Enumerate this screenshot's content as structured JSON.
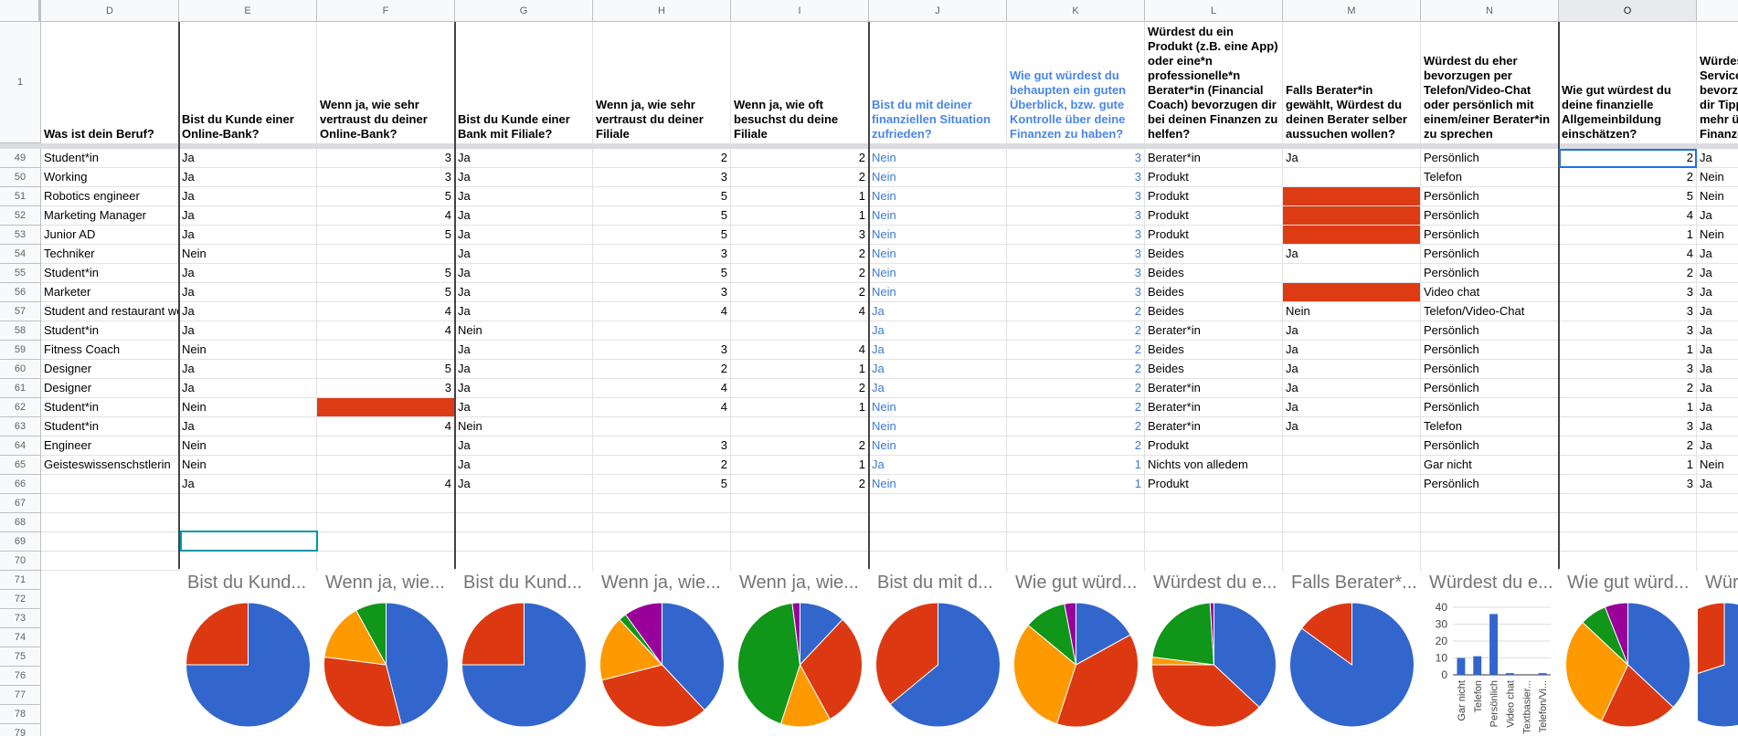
{
  "columns": [
    "D",
    "E",
    "F",
    "G",
    "H",
    "I",
    "J",
    "K",
    "L",
    "M",
    "N",
    "O",
    ""
  ],
  "selected_column": "O",
  "header_row_number": "1",
  "headers": [
    "Was ist dein Beruf?",
    "Bist du Kunde einer Online-Bank?",
    "Wenn ja, wie sehr vertraust du deiner Online-Bank?",
    "Bist du Kunde einer Bank mit Filiale?",
    "Wenn ja, wie sehr vertraust du deiner Filiale",
    "Wenn ja, wie oft besuchst du deine Filiale",
    "Bist du mit deiner finanziellen Situation zufrieden?",
    "Wie gut würdest du behaupten ein guten Überblick, bzw. gute Kontrolle über deine Finanzen zu haben?",
    "Würdest du ein Produkt (z.B. eine App) oder eine*n professionelle*n Berater*in (Financial Coach) bevorzugen dir bei deinen Finanzen zu helfen?",
    "Falls Berater*in gewählt, Würdest du deinen Berater selber aussuchen wollen?",
    "Würdest du eher bevorzugen per Telefon/Video-Chat oder persönlich mit einem/einer Berater*in zu sprechen",
    "Wie gut würdest du deine finanzielle Allgemeinbildung einschätzen?",
    "Würdest du Service bevorzugen dir Tipps mehr über Finanzen"
  ],
  "rows": [
    {
      "n": "49",
      "c": [
        "Student*in",
        "Ja",
        "3",
        "Ja",
        "2",
        "2",
        "Nein",
        "3",
        "Berater*in",
        "Ja",
        "Persönlich",
        "2",
        "Ja"
      ]
    },
    {
      "n": "50",
      "c": [
        "Working",
        "Ja",
        "3",
        "Ja",
        "3",
        "2",
        "Nein",
        "3",
        "Produkt",
        "",
        "Telefon",
        "2",
        "Nein"
      ]
    },
    {
      "n": "51",
      "c": [
        "Robotics engineer",
        "Ja",
        "5",
        "Ja",
        "5",
        "1",
        "Nein",
        "3",
        "Produkt",
        "",
        "Persönlich",
        "5",
        "Nein"
      ]
    },
    {
      "n": "52",
      "c": [
        "Marketing Manager",
        "Ja",
        "4",
        "Ja",
        "5",
        "1",
        "Nein",
        "3",
        "Produkt",
        "",
        "Persönlich",
        "4",
        "Ja"
      ]
    },
    {
      "n": "53",
      "c": [
        "Junior AD",
        "Ja",
        "5",
        "Ja",
        "5",
        "3",
        "Nein",
        "3",
        "Produkt",
        "",
        "Persönlich",
        "1",
        "Nein"
      ]
    },
    {
      "n": "54",
      "c": [
        "Techniker",
        "Nein",
        "",
        "Ja",
        "3",
        "2",
        "Nein",
        "3",
        "Beides",
        "Ja",
        "Persönlich",
        "4",
        "Ja"
      ]
    },
    {
      "n": "55",
      "c": [
        "Student*in",
        "Ja",
        "5",
        "Ja",
        "5",
        "2",
        "Nein",
        "3",
        "Beides",
        "",
        "Persönlich",
        "2",
        "Ja"
      ]
    },
    {
      "n": "56",
      "c": [
        "Marketer",
        "Ja",
        "5",
        "Ja",
        "3",
        "2",
        "Nein",
        "3",
        "Beides",
        "",
        "Video chat",
        "3",
        "Ja"
      ]
    },
    {
      "n": "57",
      "c": [
        "Student and restaurant worker",
        "Ja",
        "4",
        "Ja",
        "4",
        "4",
        "Ja",
        "2",
        "Beides",
        "Nein",
        "Telefon/Video-Chat",
        "3",
        "Ja"
      ]
    },
    {
      "n": "58",
      "c": [
        "Student*in",
        "Ja",
        "4",
        "Nein",
        "",
        "",
        "Ja",
        "2",
        "Berater*in",
        "Ja",
        "Persönlich",
        "3",
        "Ja"
      ]
    },
    {
      "n": "59",
      "c": [
        "Fitness Coach",
        "Nein",
        "",
        "Ja",
        "3",
        "4",
        "Ja",
        "2",
        "Beides",
        "Ja",
        "Persönlich",
        "1",
        "Ja"
      ]
    },
    {
      "n": "60",
      "c": [
        "Designer",
        "Ja",
        "5",
        "Ja",
        "2",
        "1",
        "Ja",
        "2",
        "Beides",
        "Ja",
        "Persönlich",
        "3",
        "Ja"
      ]
    },
    {
      "n": "61",
      "c": [
        "Designer",
        "Ja",
        "3",
        "Ja",
        "4",
        "2",
        "Ja",
        "2",
        "Berater*in",
        "Ja",
        "Persönlich",
        "2",
        "Ja"
      ]
    },
    {
      "n": "62",
      "c": [
        "Student*in",
        "Nein",
        "",
        "Ja",
        "4",
        "1",
        "Nein",
        "2",
        "Berater*in",
        "Ja",
        "Persönlich",
        "1",
        "Ja"
      ]
    },
    {
      "n": "63",
      "c": [
        "Student*in",
        "Ja",
        "4",
        "Nein",
        "",
        "",
        "Nein",
        "2",
        "Berater*in",
        "Ja",
        "Telefon",
        "3",
        "Ja"
      ]
    },
    {
      "n": "64",
      "c": [
        "Engineer",
        "Nein",
        "",
        "Ja",
        "3",
        "2",
        "Nein",
        "2",
        "Produkt",
        "",
        "Persönlich",
        "2",
        "Ja"
      ]
    },
    {
      "n": "65",
      "c": [
        "Geisteswissenschstlerin",
        "Nein",
        "",
        "Ja",
        "2",
        "1",
        "Ja",
        "1",
        "Nichts von alledem",
        "",
        "Gar nicht",
        "1",
        "Nein"
      ]
    },
    {
      "n": "66",
      "c": [
        "",
        "Ja",
        "4",
        "Ja",
        "5",
        "2",
        "Nein",
        "1",
        "Produkt",
        "",
        "Persönlich",
        "3",
        "Ja"
      ]
    }
  ],
  "empty_rows": [
    "67",
    "68",
    "69",
    "70",
    "71",
    "72",
    "73",
    "74",
    "75",
    "76",
    "77",
    "78",
    "79"
  ],
  "red_cells": [
    {
      "row": "53",
      "col": 9
    },
    {
      "row": "51",
      "col": 9
    },
    {
      "row": "52",
      "col": 9
    },
    {
      "row": "56",
      "col": 9
    },
    {
      "row": "62",
      "col": 2
    }
  ],
  "colors": {
    "blue": "#3366cc",
    "red": "#dc3912",
    "orange": "#ff9900",
    "green": "#109618",
    "purple": "#990099",
    "fill_red": "#dd3b14",
    "link_blue": "#4a86e8"
  },
  "charts": [
    {
      "col": 1,
      "title": "Bist du Kund...",
      "type": "pie",
      "slices": [
        {
          "v": 75,
          "c": "#3366cc"
        },
        {
          "v": 25,
          "c": "#dc3912"
        }
      ]
    },
    {
      "col": 2,
      "title": "Wenn ja, wie...",
      "type": "pie",
      "slices": [
        {
          "v": 46,
          "c": "#3366cc"
        },
        {
          "v": 31,
          "c": "#dc3912"
        },
        {
          "v": 15,
          "c": "#ff9900"
        },
        {
          "v": 8,
          "c": "#109618"
        }
      ]
    },
    {
      "col": 3,
      "title": "Bist du Kund...",
      "type": "pie",
      "slices": [
        {
          "v": 75,
          "c": "#3366cc"
        },
        {
          "v": 25,
          "c": "#dc3912"
        }
      ]
    },
    {
      "col": 4,
      "title": "Wenn ja, wie...",
      "type": "pie",
      "slices": [
        {
          "v": 38,
          "c": "#3366cc"
        },
        {
          "v": 33,
          "c": "#dc3912"
        },
        {
          "v": 17,
          "c": "#ff9900"
        },
        {
          "v": 2,
          "c": "#109618"
        },
        {
          "v": 10,
          "c": "#990099"
        }
      ]
    },
    {
      "col": 5,
      "title": "Wenn ja, wie...",
      "type": "pie",
      "slices": [
        {
          "v": 12,
          "c": "#3366cc"
        },
        {
          "v": 30,
          "c": "#dc3912"
        },
        {
          "v": 13,
          "c": "#ff9900"
        },
        {
          "v": 43,
          "c": "#109618"
        },
        {
          "v": 2,
          "c": "#990099"
        }
      ]
    },
    {
      "col": 6,
      "title": "Bist du mit d...",
      "type": "pie",
      "slices": [
        {
          "v": 64,
          "c": "#3366cc"
        },
        {
          "v": 36,
          "c": "#dc3912"
        }
      ]
    },
    {
      "col": 7,
      "title": "Wie gut würd...",
      "type": "pie",
      "slices": [
        {
          "v": 17,
          "c": "#3366cc"
        },
        {
          "v": 38,
          "c": "#dc3912"
        },
        {
          "v": 31,
          "c": "#ff9900"
        },
        {
          "v": 11,
          "c": "#109618"
        },
        {
          "v": 3,
          "c": "#990099"
        }
      ]
    },
    {
      "col": 8,
      "title": "Würdest du e...",
      "type": "pie",
      "slices": [
        {
          "v": 37,
          "c": "#3366cc"
        },
        {
          "v": 38,
          "c": "#dc3912"
        },
        {
          "v": 2,
          "c": "#ff9900"
        },
        {
          "v": 22,
          "c": "#109618"
        },
        {
          "v": 1,
          "c": "#990099"
        }
      ]
    },
    {
      "col": 9,
      "title": "Falls Berater*...",
      "type": "pie",
      "slices": [
        {
          "v": 85,
          "c": "#3366cc"
        },
        {
          "v": 15,
          "c": "#dc3912"
        }
      ]
    },
    {
      "col": 10,
      "title": "Würdest du e...",
      "type": "bar"
    },
    {
      "col": 11,
      "title": "Wie gut würd...",
      "type": "pie",
      "slices": [
        {
          "v": 37,
          "c": "#3366cc"
        },
        {
          "v": 20,
          "c": "#dc3912"
        },
        {
          "v": 30,
          "c": "#ff9900"
        },
        {
          "v": 7,
          "c": "#109618"
        },
        {
          "v": 6,
          "c": "#990099"
        }
      ]
    },
    {
      "col": 12,
      "title": "Wür",
      "type": "pie",
      "slices": [
        {
          "v": 70,
          "c": "#3366cc"
        },
        {
          "v": 30,
          "c": "#dc3912"
        }
      ]
    }
  ],
  "chart_data": {
    "type": "bar",
    "title": "Würdest du e...",
    "categories": [
      "Gar nicht",
      "Telefon",
      "Persönlich",
      "Video chat",
      "Textbasier...",
      "Telefon/Vi..."
    ],
    "values": [
      10,
      11,
      36,
      1,
      0,
      1
    ],
    "ylim": [
      0,
      40
    ],
    "yticks": [
      "0",
      "10",
      "20",
      "30",
      "40"
    ],
    "grid": true
  }
}
